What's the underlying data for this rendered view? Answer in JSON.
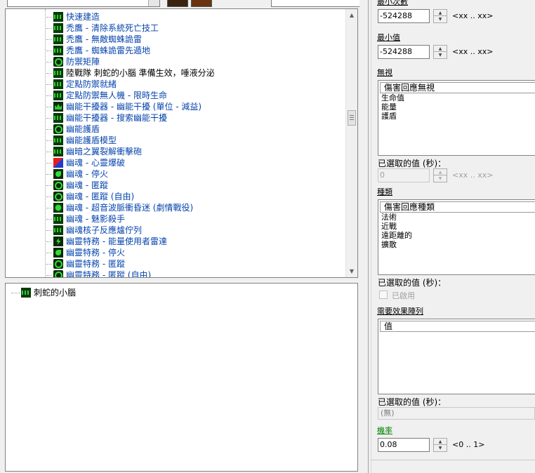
{
  "toolbar": {
    "object_filter_value": "",
    "search_value": ""
  },
  "tree": {
    "items": [
      {
        "label": "快速建造",
        "icon": "leaf"
      },
      {
        "label": "禿鷹 - 清除系統死亡技工",
        "icon": "leaf"
      },
      {
        "label": "禿鷹 - 無敵蜘蛛詭雷",
        "icon": "leaf"
      },
      {
        "label": "禿鷹 - 蜘蛛詭雷先遁地",
        "icon": "leaf"
      },
      {
        "label": "防禦矩陣",
        "icon": "ring"
      },
      {
        "label": "陸戰隊 刺蛇的小腦 準備生效，唾液分泌",
        "icon": "leaf",
        "black": true
      },
      {
        "label": "定點防禦就緒",
        "icon": "leaf"
      },
      {
        "label": "定點防禦無人機 - 限時生命",
        "icon": "leaf"
      },
      {
        "label": "幽能干擾器 - 幽能干擾 (單位 - 減益)",
        "icon": "crown"
      },
      {
        "label": "幽能干擾器 - 搜索幽能干擾",
        "icon": "leaf"
      },
      {
        "label": "幽能護盾",
        "icon": "ring"
      },
      {
        "label": "幽能護盾模型",
        "icon": "leaf"
      },
      {
        "label": "幽暗之翼裂解衝擊砲",
        "icon": "leaf"
      },
      {
        "label": "幽魂 - 心靈爆破",
        "icon": "red"
      },
      {
        "label": "幽魂 - 停火",
        "icon": "hand"
      },
      {
        "label": "幽魂 - 匿蹤",
        "icon": "ring"
      },
      {
        "label": "幽魂 - 匿蹤 (自由)",
        "icon": "ring"
      },
      {
        "label": "幽魂 - 超音波脈衝昏迷 (劇情戰役)",
        "icon": "star"
      },
      {
        "label": "幽魂 - 魅影殺手",
        "icon": "leaf"
      },
      {
        "label": "幽魂核子反應爐佇列",
        "icon": "leaf"
      },
      {
        "label": "幽靈特務 - 能量使用者雷達",
        "icon": "bolt"
      },
      {
        "label": "幽靈特務 - 停火",
        "icon": "hand"
      },
      {
        "label": "幽靈特務 - 匿蹤",
        "icon": "ring"
      },
      {
        "label": "幽靈特務 - 匿蹤 (自由)",
        "icon": "ring"
      }
    ]
  },
  "detail": {
    "node_label": "刺蛇的小腦",
    "node_icon": "leaf"
  },
  "props": {
    "min_damage_link": "最小次數",
    "min_damage_value": "-524288",
    "min_damage_range": "<xx .. xx>",
    "min_value_link": "最小值",
    "min_value_value": "-524288",
    "min_value_range": "<xx .. xx>",
    "ignore_link": "無視",
    "ignore_header": "傷害回應無視",
    "ignore_items": [
      "生命值",
      "能量",
      "護盾"
    ],
    "ignore_selected_label": "已選取的值 (秒)：",
    "ignore_selected_value": "0",
    "ignore_selected_range": "<xx .. xx>",
    "type_link": "種類",
    "type_header": "傷害回應種類",
    "type_items": [
      "法術",
      "近戰",
      "遠距離的",
      "擴散"
    ],
    "type_selected_label": "已選取的值 (秒)：",
    "enabled_label": "已啟用",
    "required_link": "需要效果陣列",
    "required_header": "值",
    "required_selected_label": "已選取的值 (秒)：",
    "required_selected_value": "(無)",
    "chance_link": "機率",
    "chance_value": "0.08",
    "chance_range": "<0 .. 1>"
  },
  "colors": {
    "link_blue": "#0645ad",
    "chance_green": "#008000"
  }
}
